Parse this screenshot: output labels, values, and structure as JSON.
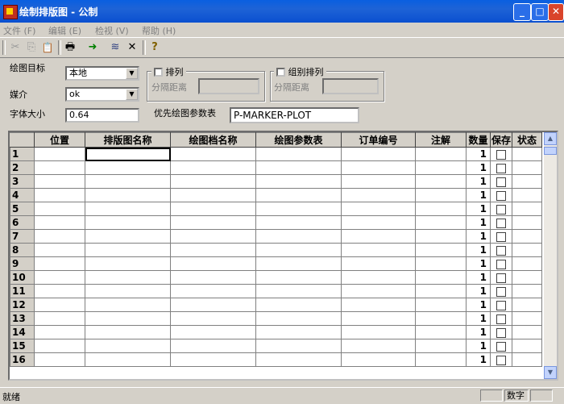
{
  "window": {
    "title": "绘制排版图 - 公制",
    "minimize_glyph": "_",
    "maximize_glyph": "□",
    "close_glyph": "✕"
  },
  "menu": [
    "文件 (F)",
    "编辑 (E)",
    "检视 (V)",
    "帮助 (H)"
  ],
  "toolbar": {
    "icons": [
      "cut-icon",
      "copy-icon",
      "paste-icon",
      "print-icon",
      "run-arrow-icon",
      "stack-icon",
      "delete-x-icon",
      "help-icon"
    ],
    "glyphs": [
      "✂",
      "⎘",
      "📋",
      "🖶",
      "➜",
      "≋",
      "✕",
      "?"
    ]
  },
  "form": {
    "target_label": "绘图目标",
    "target_value": "本地",
    "media_label": "媒介",
    "media_value": "ok",
    "fontsize_label": "字体大小",
    "fontsize_value": "0.64",
    "arrange_label": "排列",
    "arrange_spacing_label": "分隔距离",
    "group_arrange_label": "组别排列",
    "group_spacing_label": "分隔距离",
    "priority_label": "优先绘图参数表",
    "priority_value": "P-MARKER-PLOT"
  },
  "grid": {
    "headers": [
      "",
      "位置",
      "排版图名称",
      "绘图档名称",
      "绘图参数表",
      "订单编号",
      "注解",
      "数量",
      "保存",
      "状态"
    ],
    "rows": [
      {
        "n": "1",
        "qty": "1"
      },
      {
        "n": "2",
        "qty": "1"
      },
      {
        "n": "3",
        "qty": "1"
      },
      {
        "n": "4",
        "qty": "1"
      },
      {
        "n": "5",
        "qty": "1"
      },
      {
        "n": "6",
        "qty": "1"
      },
      {
        "n": "7",
        "qty": "1"
      },
      {
        "n": "8",
        "qty": "1"
      },
      {
        "n": "9",
        "qty": "1"
      },
      {
        "n": "10",
        "qty": "1"
      },
      {
        "n": "11",
        "qty": "1"
      },
      {
        "n": "12",
        "qty": "1"
      },
      {
        "n": "13",
        "qty": "1"
      },
      {
        "n": "14",
        "qty": "1"
      },
      {
        "n": "15",
        "qty": "1"
      },
      {
        "n": "16",
        "qty": "1"
      }
    ]
  },
  "status": {
    "left": "就绪",
    "num": "数字"
  }
}
